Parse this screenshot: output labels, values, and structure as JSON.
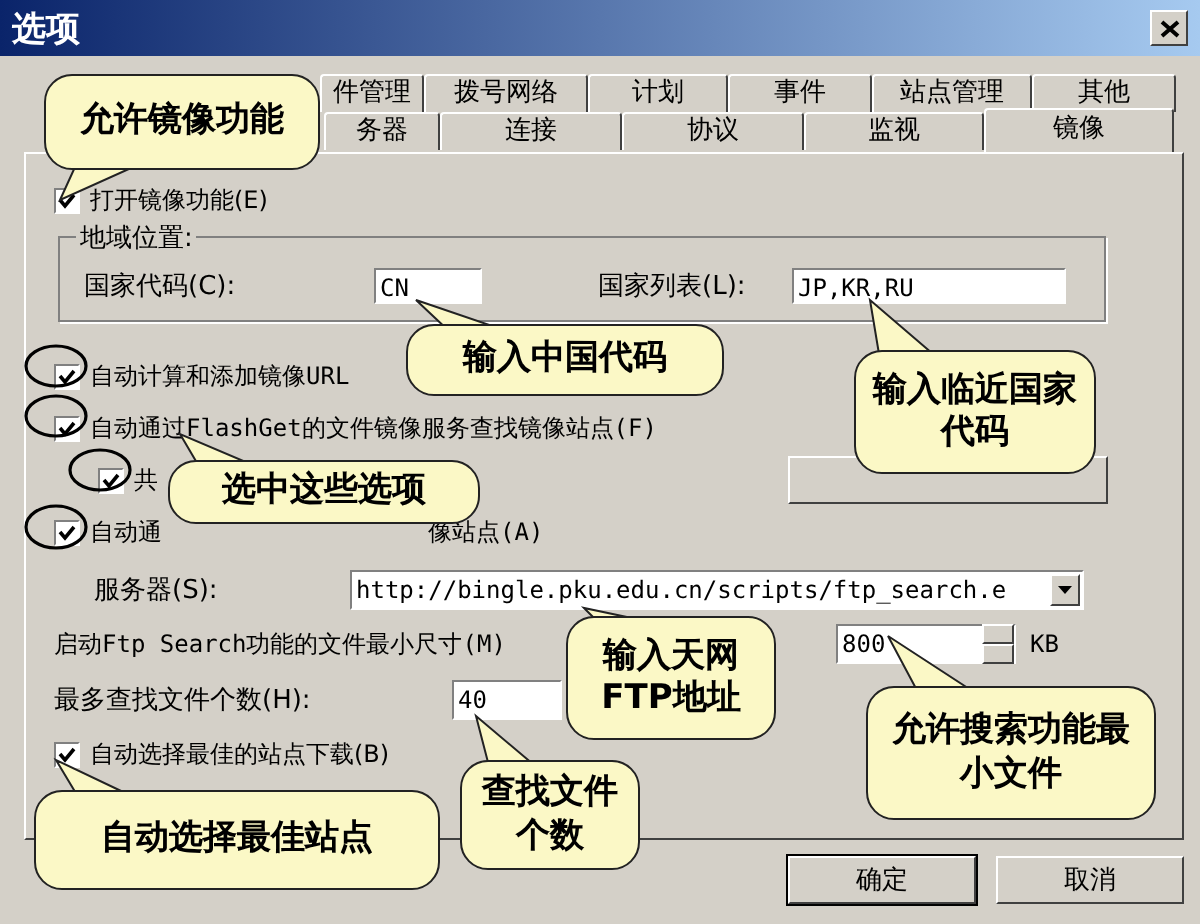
{
  "window": {
    "title": "选项"
  },
  "tabs_row_1": [
    {
      "label": "件管理",
      "selected": false
    },
    {
      "label": "拨号网络",
      "selected": false
    },
    {
      "label": "计划",
      "selected": false
    },
    {
      "label": "事件",
      "selected": false
    },
    {
      "label": "站点管理",
      "selected": false
    },
    {
      "label": "其他",
      "selected": false
    }
  ],
  "tabs_row_2": [
    {
      "label": "务器",
      "selected": false
    },
    {
      "label": "连接",
      "selected": false
    },
    {
      "label": "协议",
      "selected": false
    },
    {
      "label": "监视",
      "selected": false
    },
    {
      "label": "镜像",
      "selected": true
    }
  ],
  "enable_mirror": {
    "label": "打开镜像功能(E)",
    "checked": true
  },
  "region_group": {
    "title": "地域位置:",
    "country_code": {
      "label": "国家代码(C):",
      "value": "CN"
    },
    "country_list": {
      "label": "国家列表(L):",
      "value": "JP,KR,RU"
    }
  },
  "options": [
    {
      "label": "自动计算和添加镜像URL",
      "checked": true,
      "indented": false
    },
    {
      "label": "自动通过FlashGet的文件镜像服务查找镜像站点(F)",
      "checked": true,
      "indented": false
    },
    {
      "label": "共",
      "checked": true,
      "indented": true
    },
    {
      "label": "自动通",
      "label_after": "像站点(A)",
      "checked": true,
      "indented": false
    }
  ],
  "server": {
    "label": "服务器(S):",
    "value": "http://bingle.pku.edu.cn/scripts/ftp_search.e"
  },
  "min_size": {
    "label": "启动Ftp Search功能的文件最小尺寸(M)",
    "value": "800",
    "unit": "KB"
  },
  "max_files": {
    "label": "最多查找文件个数(H):",
    "value": "40"
  },
  "auto_best": {
    "label": "自动选择最佳的站点下载(B)",
    "checked": true
  },
  "buttons": [
    {
      "label": "确定"
    },
    {
      "label": "取消"
    }
  ],
  "callouts": [
    {
      "text": "允许镜像功能"
    },
    {
      "text": "输入中国代码"
    },
    {
      "text": "输入临近国家代码"
    },
    {
      "text": "选中这些选项"
    },
    {
      "text": "输入天网FTP地址"
    },
    {
      "text": "允许搜索功能最小文件"
    },
    {
      "text": "自动选择最佳站点"
    },
    {
      "text": "查找文件个数"
    }
  ]
}
